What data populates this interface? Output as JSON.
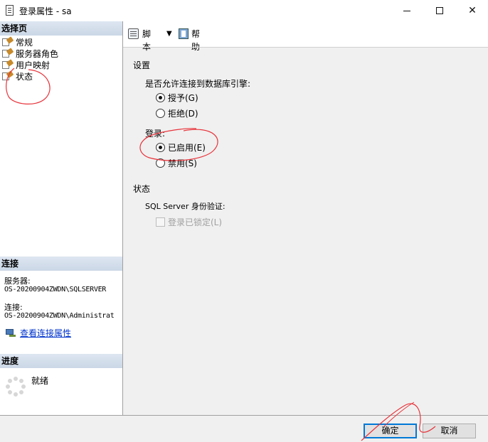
{
  "window": {
    "title": "登录属性 - sa"
  },
  "left": {
    "select_page_header": "选择页",
    "pages": [
      {
        "label": "常规"
      },
      {
        "label": "服务器角色"
      },
      {
        "label": "用户映射"
      },
      {
        "label": "状态"
      }
    ],
    "connection_header": "连接",
    "server_label": "服务器:",
    "server_value": "OS-20200904ZWDN\\SQLSERVER",
    "connection_label": "连接:",
    "connection_value": "OS-20200904ZWDN\\Administrat",
    "view_connection_link": "查看连接属性",
    "progress_header": "进度",
    "progress_status": "就绪"
  },
  "toolbar": {
    "script_label": "脚本",
    "help_label": "帮助"
  },
  "settings": {
    "section_label": "设置",
    "db_engine_question": "是否允许连接到数据库引擎:",
    "grant_label": "授予(G)",
    "deny_label": "拒绝(D)",
    "login_label": "登录:",
    "enabled_label": "已启用(E)",
    "disabled_label": "禁用(S)",
    "status_section_label": "状态",
    "sql_auth_label": "SQL Server 身份验证:",
    "locked_label": "登录已锁定(L)",
    "grant_selected": true,
    "enabled_selected": true,
    "locked_checked": false
  },
  "buttons": {
    "ok_label": "确定",
    "cancel_label": "取消"
  },
  "colors": {
    "annotation": "#e8333a",
    "header_bg": "#cbd7e6",
    "ok_focus": "#0078d7"
  }
}
